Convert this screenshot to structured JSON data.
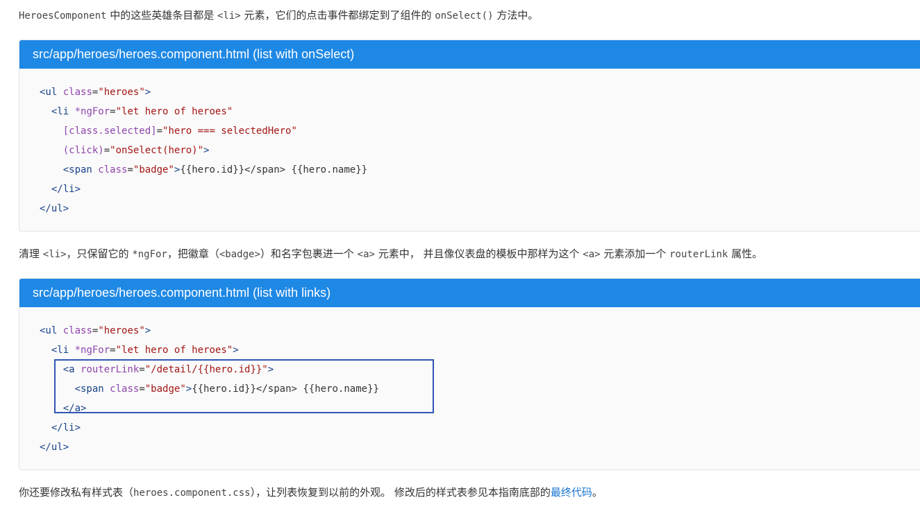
{
  "intro": {
    "t1": "HeroesComponent",
    "t2": " 中的这些英雄条目都是 ",
    "t3": "<li>",
    "t4": " 元素，它们的点击事件都绑定到了组件的 ",
    "t5": "onSelect()",
    "t6": " 方法中。"
  },
  "panel1": {
    "title": "src/app/heroes/heroes.component.html (list with onSelect)",
    "lines": [
      [
        "",
        "<ul",
        " class",
        "=",
        "\"heroes\"",
        ">",
        ""
      ],
      [
        "  ",
        "<li",
        " *ngFor",
        "=",
        "\"let hero of heroes\"",
        "",
        ""
      ],
      [
        "    ",
        "",
        "[class.selected]",
        "=",
        "\"hero === selectedHero\"",
        "",
        ""
      ],
      [
        "    ",
        "",
        "(click)",
        "=",
        "\"onSelect(hero)\"",
        ">",
        ""
      ],
      [
        "    ",
        "<span",
        " class",
        "=",
        "\"badge\"",
        ">",
        "{{hero.id}}</span> {{hero.name}}"
      ],
      [
        "  ",
        "</li>",
        "",
        "",
        "",
        "",
        ""
      ],
      [
        "",
        "</ul>",
        "",
        "",
        "",
        "",
        ""
      ]
    ]
  },
  "middle": {
    "t1": "清理 ",
    "t2": "<li>",
    "t3": "，只保留它的 ",
    "t4": "*ngFor",
    "t5": "，把徽章（",
    "t6": "<badge>",
    "t7": "）和名字包裹进一个 ",
    "t8": "<a>",
    "t9": " 元素中， 并且像仪表盘的模板中那样为这个 ",
    "t10": "<a>",
    "t11": " 元素添加一个 ",
    "t12": "routerLink",
    "t13": " 属性。"
  },
  "panel2": {
    "title": "src/app/heroes/heroes.component.html (list with links)",
    "lines": [
      [
        "",
        "<ul",
        " class",
        "=",
        "\"heroes\"",
        ">",
        ""
      ],
      [
        "  ",
        "<li",
        " *ngFor",
        "=",
        "\"let hero of heroes\"",
        ">",
        ""
      ],
      [
        "    ",
        "<a",
        " routerLink",
        "=",
        "\"/detail/{{hero.id}}\"",
        ">",
        ""
      ],
      [
        "      ",
        "<span",
        " class",
        "=",
        "\"badge\"",
        ">",
        "{{hero.id}}</span> {{hero.name}}"
      ],
      [
        "    ",
        "</a>",
        "",
        "",
        "",
        "",
        ""
      ],
      [
        "  ",
        "</li>",
        "",
        "",
        "",
        "",
        ""
      ],
      [
        "",
        "</ul>",
        "",
        "",
        "",
        "",
        ""
      ]
    ]
  },
  "outro": {
    "t1": "你还要修改私有样式表（",
    "t2": "heroes.component.css",
    "t3": "），让列表恢复到以前的外观。 修改后的样式表参见本指南底部的",
    "link": "最终代码",
    "t4": "。"
  },
  "colors": {
    "panel_header": "#1e88e5",
    "highlight_border": "#2f55b4",
    "link": "#1976d2"
  }
}
